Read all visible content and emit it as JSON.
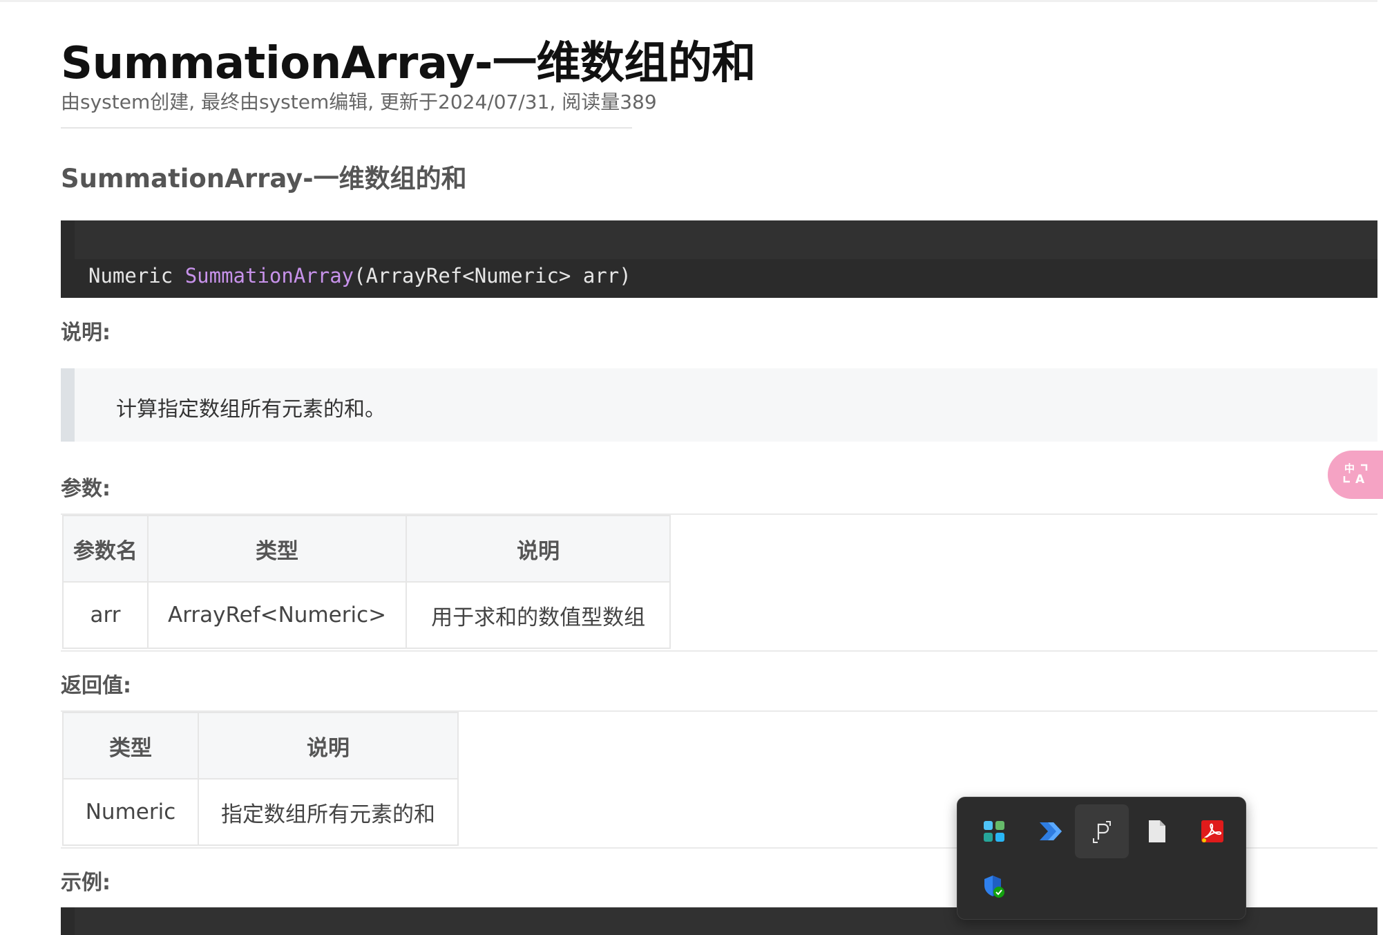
{
  "page": {
    "title": "SummationArray-一维数组的和",
    "meta": "由system创建, 最终由system编辑, 更新于2024/07/31, 阅读量389",
    "section_title": "SummationArray-一维数组的和"
  },
  "signature": {
    "return_type": "Numeric ",
    "function_name": "SummationArray",
    "params": "(ArrayRef<Numeric> arr)"
  },
  "description": {
    "label": "说明:",
    "text": "计算指定数组所有元素的和。"
  },
  "parameters": {
    "label": "参数:",
    "headers": [
      "参数名",
      "类型",
      "说明"
    ],
    "rows": [
      [
        "arr",
        "ArrayRef<Numeric>",
        "用于求和的数值型数组"
      ]
    ]
  },
  "returns": {
    "label": "返回值:",
    "headers": [
      "类型",
      "说明"
    ],
    "rows": [
      [
        "Numeric",
        "指定数组所有元素的和"
      ]
    ]
  },
  "example": {
    "label": "示例:"
  },
  "floating": {
    "translate_icon": "translate-icon"
  },
  "tray": {
    "icons": [
      "app-tile-icon",
      "power-automate-icon",
      "snipping-tool-icon",
      "file-icon",
      "acrobat-icon",
      "security-shield-icon"
    ]
  },
  "colors": {
    "code_bg": "#2b2b2b",
    "function_name": "#c792ea",
    "translate_fab": "#f5a3c4",
    "tray_bg": "#2c2c2c"
  }
}
